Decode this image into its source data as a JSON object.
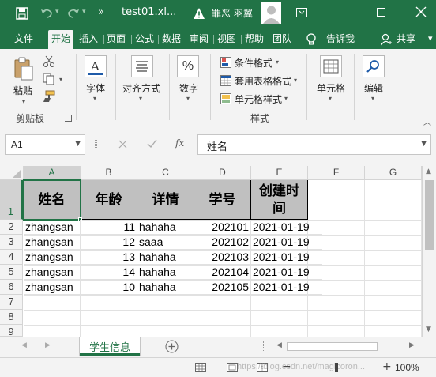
{
  "titlebar": {
    "filename": "test01.xl...",
    "user_name": "罪恶 羽翼",
    "more_symbol": "»"
  },
  "tabs": [
    "文件",
    "开始",
    "插入",
    "页面",
    "公式",
    "数据",
    "审阅",
    "视图",
    "帮助",
    "团队"
  ],
  "tell_me": "告诉我",
  "share": "共享",
  "ribbon": {
    "paste": "粘贴",
    "clipboard_group": "剪贴板",
    "font": "字体",
    "alignment": "对齐方式",
    "number": "数字",
    "number_glyph": "%",
    "conditional_format": "条件格式",
    "table_format": "套用表格格式",
    "cell_style": "单元格样式",
    "styles_group": "样式",
    "cells": "单元格",
    "editing": "编辑"
  },
  "formula_bar": {
    "name_box": "A1",
    "fx": "fx",
    "content": "姓名"
  },
  "columns": [
    "A",
    "B",
    "C",
    "D",
    "E",
    "F",
    "G"
  ],
  "rows": [
    "1",
    "2",
    "3",
    "4",
    "5",
    "6",
    "7",
    "8",
    "9"
  ],
  "header_row": [
    "姓名",
    "年龄",
    "详情",
    "学号",
    "创建时间"
  ],
  "data_rows": [
    [
      "zhangsan",
      "11",
      "hahaha",
      "202101",
      "2021-01-19"
    ],
    [
      "zhangsan",
      "12",
      "saaa",
      "202102",
      "2021-01-19"
    ],
    [
      "zhangsan",
      "13",
      "hahaha",
      "202103",
      "2021-01-19"
    ],
    [
      "zhangsan",
      "14",
      "hahaha",
      "202104",
      "2021-01-19"
    ],
    [
      "zhangsan",
      "10",
      "hahaha",
      "202105",
      "2021-01-19"
    ]
  ],
  "sheet_tab": "学生信息",
  "status": {
    "watermark": "https://blog.csdn.net/magicoron...",
    "zoom": "100%"
  },
  "colors": {
    "brand": "#217346",
    "header_fill": "#c0c0c0"
  }
}
